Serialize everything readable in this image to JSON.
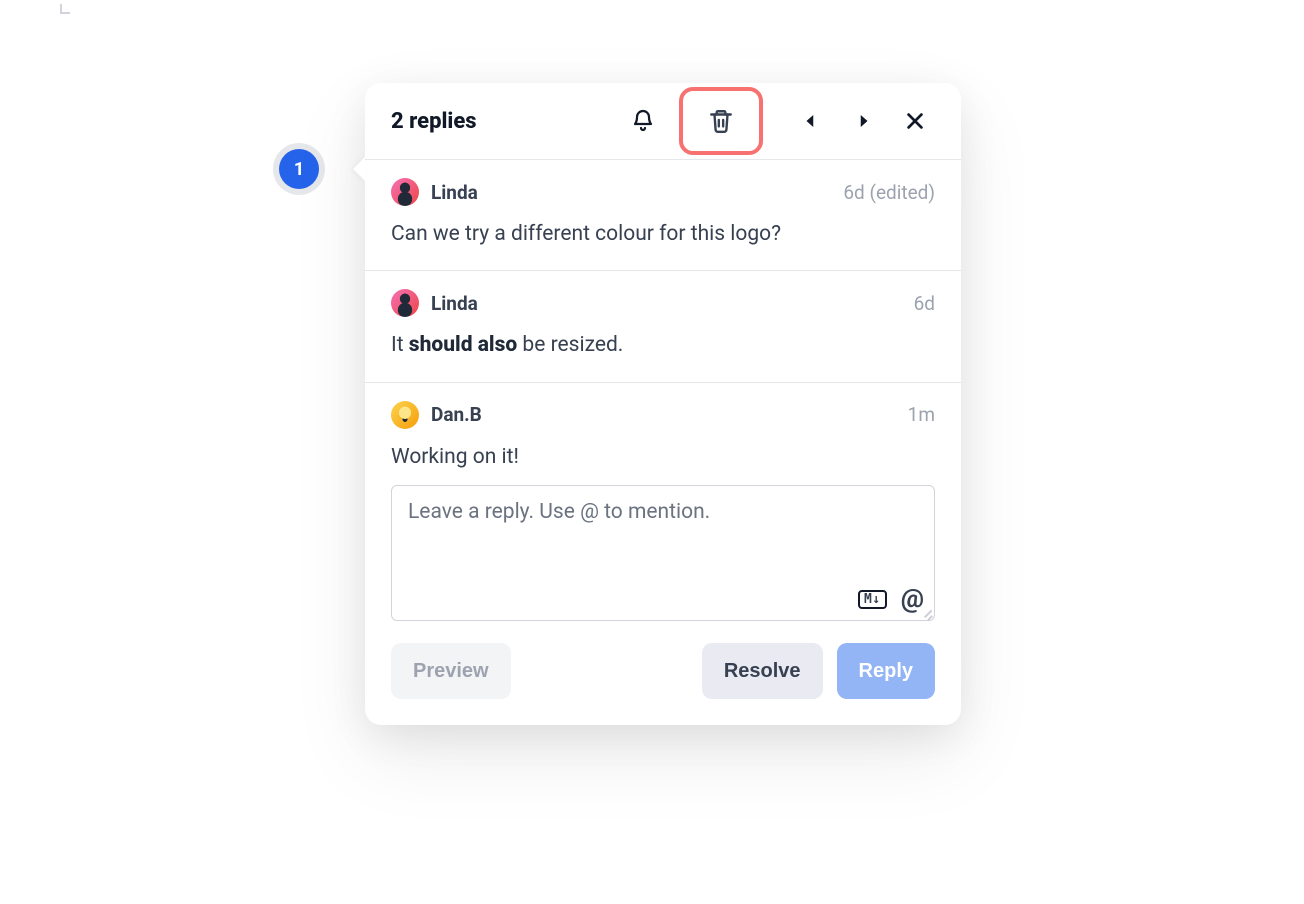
{
  "marker": {
    "number": "1"
  },
  "header": {
    "title": "2 replies"
  },
  "comments": [
    {
      "author": "Linda",
      "avatar": "linda",
      "meta": "6d (edited)",
      "body_plain": "Can we try a different colour for this logo?"
    },
    {
      "author": "Linda",
      "avatar": "linda",
      "meta": "6d",
      "body_prefix": "It ",
      "body_bold": "should also",
      "body_suffix": " be resized."
    },
    {
      "author": "Dan.B",
      "avatar": "dan",
      "meta": "1m",
      "body_plain": "Working on it!"
    }
  ],
  "reply": {
    "placeholder": "Leave a reply. Use @ to mention.",
    "markdown_badge": "M↓",
    "mention_glyph": "@"
  },
  "buttons": {
    "preview": "Preview",
    "resolve": "Resolve",
    "reply": "Reply"
  },
  "highlight": {
    "color": "#f87171"
  }
}
